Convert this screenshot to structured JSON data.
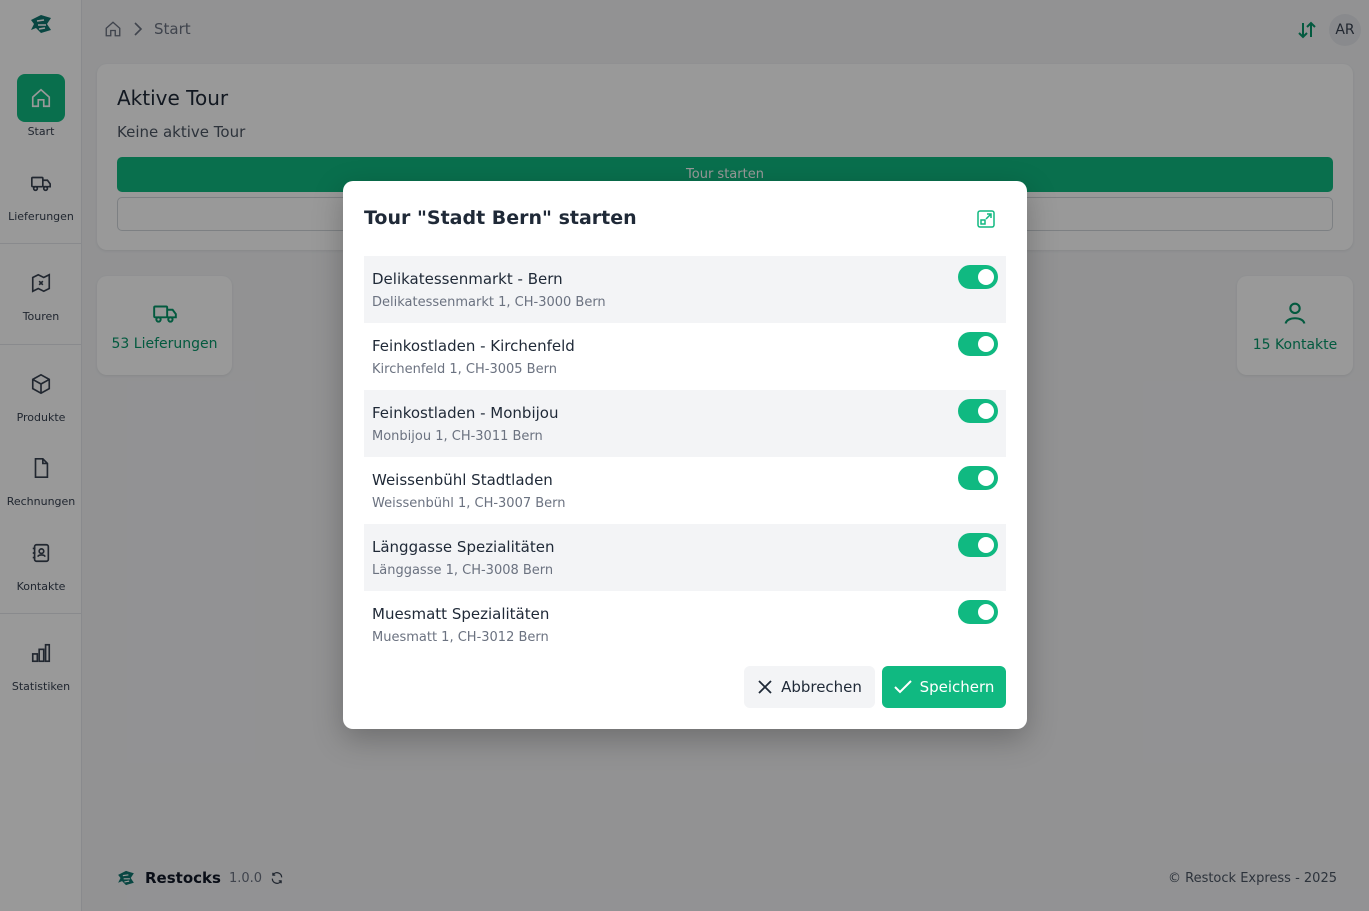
{
  "sidebar": {
    "items": [
      {
        "label": "Start",
        "icon": "home-icon"
      },
      {
        "label": "Lieferungen",
        "icon": "truck-icon"
      },
      {
        "label": "Touren",
        "icon": "map-icon"
      },
      {
        "label": "Produkte",
        "icon": "box-icon"
      },
      {
        "label": "Rechnungen",
        "icon": "file-icon"
      },
      {
        "label": "Kontakte",
        "icon": "contacts-icon"
      },
      {
        "label": "Statistiken",
        "icon": "chart-icon"
      }
    ]
  },
  "header": {
    "breadcrumb": "Start",
    "avatar": "AR"
  },
  "main": {
    "card_title": "Aktive Tour",
    "card_sub": "Keine aktive Tour",
    "start_button": "Tour starten",
    "stat_deliveries": "53 Lieferungen",
    "stat_contacts": "15 Kontakte"
  },
  "footer": {
    "brand": "Restocks",
    "version": "1.0.0",
    "copyright": "© Restock Express - 2025"
  },
  "modal": {
    "title": "Tour \"Stadt Bern\" starten",
    "stops": [
      {
        "name": "Delikatessenmarkt - Bern",
        "address": "Delikatessenmarkt 1, CH-3000 Bern",
        "enabled": true
      },
      {
        "name": "Feinkostladen - Kirchenfeld",
        "address": "Kirchenfeld 1, CH-3005 Bern",
        "enabled": true
      },
      {
        "name": "Feinkostladen - Monbijou",
        "address": "Monbijou 1, CH-3011 Bern",
        "enabled": true
      },
      {
        "name": "Weissenbühl Stadtladen",
        "address": "Weissenbühl 1, CH-3007 Bern",
        "enabled": true
      },
      {
        "name": "Länggasse Spezialitäten",
        "address": "Länggasse 1, CH-3008 Bern",
        "enabled": true
      },
      {
        "name": "Muesmatt Spezialitäten",
        "address": "Muesmatt 1, CH-3012 Bern",
        "enabled": true
      }
    ],
    "cancel_label": "Abbrechen",
    "save_label": "Speichern"
  },
  "colors": {
    "accent": "#10b981"
  }
}
